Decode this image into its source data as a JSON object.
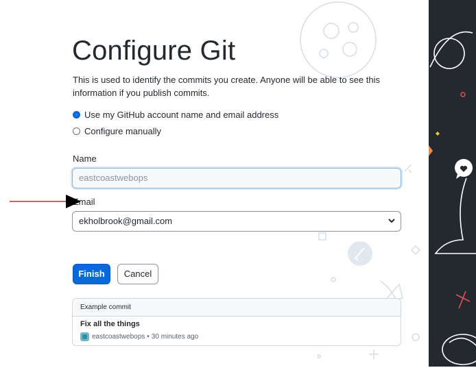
{
  "page": {
    "title": "Configure Git",
    "description": "This is used to identify the commits you create. Anyone will be able to see this information if you publish commits."
  },
  "options": {
    "use_github": "Use my GitHub account name and email address",
    "configure_manually": "Configure manually",
    "selected": "use_github"
  },
  "name_field": {
    "label": "Name",
    "value": "eastcoastwebops"
  },
  "email_field": {
    "label": "Email",
    "value": "ekholbrook@gmail.com"
  },
  "buttons": {
    "finish": "Finish",
    "cancel": "Cancel"
  },
  "example_commit": {
    "header": "Example commit",
    "message": "Fix all the things",
    "author": "eastcoastwebops",
    "separator": "•",
    "time": "30 minutes ago"
  },
  "colors": {
    "accent": "#0969da",
    "dark_panel": "#24292f",
    "annotation_arrow": "#e01e1e"
  }
}
